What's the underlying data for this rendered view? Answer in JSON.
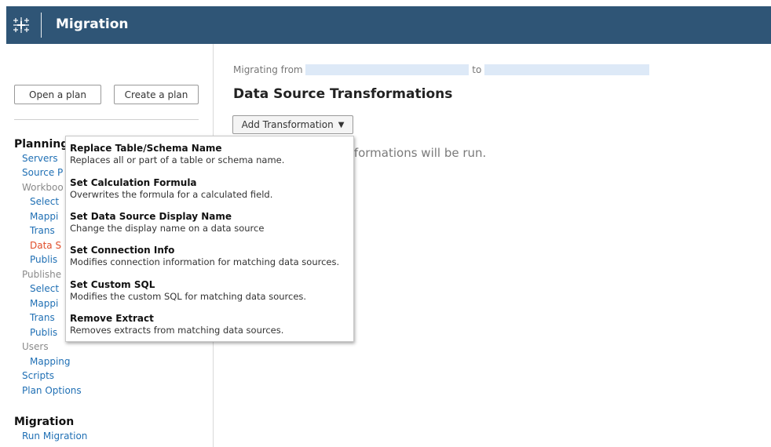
{
  "header": {
    "title": "Migration",
    "background": "#2f5576"
  },
  "sidebar": {
    "open_plan": "Open a plan",
    "create_plan": "Create a plan",
    "planning_heading": "Planning",
    "items": {
      "servers": "Servers",
      "source_projects": "Source P",
      "workbooks": "Workboo",
      "wb_select": "Select",
      "wb_mapping": "Mappi",
      "wb_transformations": "Trans",
      "wb_data_source": "Data S",
      "wb_publish": "Publis",
      "published": "Publishe",
      "pub_select": "Select",
      "pub_mapping": "Mappi",
      "pub_transformations": "Trans",
      "pub_publish": "Publis",
      "users": "Users",
      "users_mapping": "Mapping",
      "scripts": "Scripts",
      "plan_options": "Plan Options"
    },
    "migration_heading": "Migration",
    "run_migration": "Run Migration",
    "active_color": "#e04e2a",
    "link_color": "#1f6fb4"
  },
  "main": {
    "migrating_from_label": "Migrating from",
    "to_label": "to",
    "title": "Data Source Transformations",
    "add_transformation": "Add Transformation",
    "info_text": "sformations will be run."
  },
  "menu": {
    "items": [
      {
        "title": "Replace Table/Schema Name",
        "desc": "Replaces all or part of a table or schema name."
      },
      {
        "title": "Set Calculation Formula",
        "desc": "Overwrites the formula for a calculated field."
      },
      {
        "title": "Set Data Source Display Name",
        "desc": "Change the display name on a data source"
      },
      {
        "title": "Set Connection Info",
        "desc": "Modifies connection information for matching data sources."
      },
      {
        "title": "Set Custom SQL",
        "desc": "Modifies the custom SQL for matching data sources."
      },
      {
        "title": "Remove Extract",
        "desc": "Removes extracts from matching data sources."
      }
    ]
  }
}
